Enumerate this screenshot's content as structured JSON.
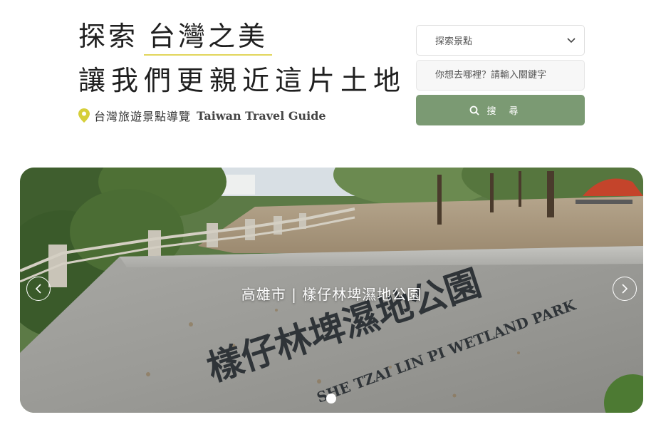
{
  "hero": {
    "title_prefix": "探索",
    "title_accent": "台灣之美",
    "subtitle": "讓我們更親近這片土地",
    "guide_zh": "台灣旅遊景點導覽",
    "guide_en": "Taiwan Travel Guide",
    "pin_icon": "map-pin-icon",
    "accent_color": "#e2d65c"
  },
  "search": {
    "select_value": "探索景點",
    "keyword_placeholder": "你想去哪裡？請輸入關鍵字",
    "button_label": "搜尋",
    "button_color": "#7b9a73"
  },
  "carousel": {
    "caption": "高雄市 | 樣仔林埤濕地公園",
    "sign_text_zh": "樣仔林埤濕地公園",
    "sign_text_en": "SHE TZAI LIN PI WETLAND PARK",
    "prev_icon": "chevron-left-icon",
    "next_icon": "chevron-right-icon",
    "active_slide": 1
  }
}
